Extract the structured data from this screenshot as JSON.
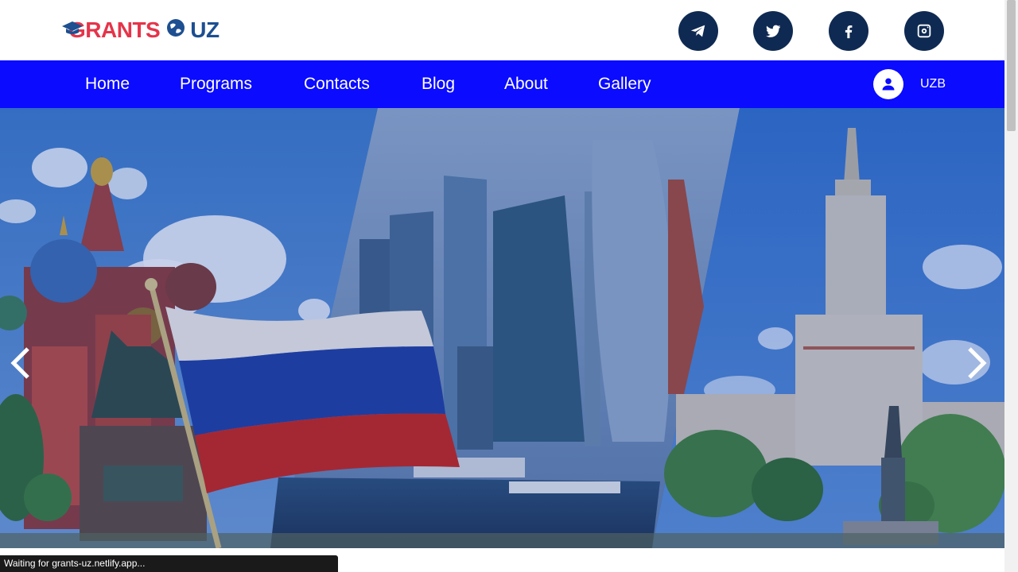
{
  "header": {
    "logo": {
      "word1": "GRANTS",
      "word2": "UZ"
    },
    "socials": [
      {
        "name": "telegram",
        "icon": "telegram-icon"
      },
      {
        "name": "twitter",
        "icon": "twitter-icon"
      },
      {
        "name": "facebook",
        "icon": "facebook-icon"
      },
      {
        "name": "instagram",
        "icon": "instagram-icon"
      }
    ]
  },
  "nav": {
    "items": [
      "Home",
      "Programs",
      "Contacts",
      "Blog",
      "About",
      "Gallery"
    ],
    "language": "UZB",
    "user_icon": "user-icon"
  },
  "hero": {
    "prev_icon": "chevron-left-icon",
    "next_icon": "chevron-right-icon"
  },
  "status_bar": {
    "text": "Waiting for grants-uz.netlify.app..."
  },
  "colors": {
    "nav_bg": "#0a0bff",
    "social_bg": "#0f2a52",
    "logo_red": "#e5344a",
    "logo_blue": "#1d4f91"
  }
}
